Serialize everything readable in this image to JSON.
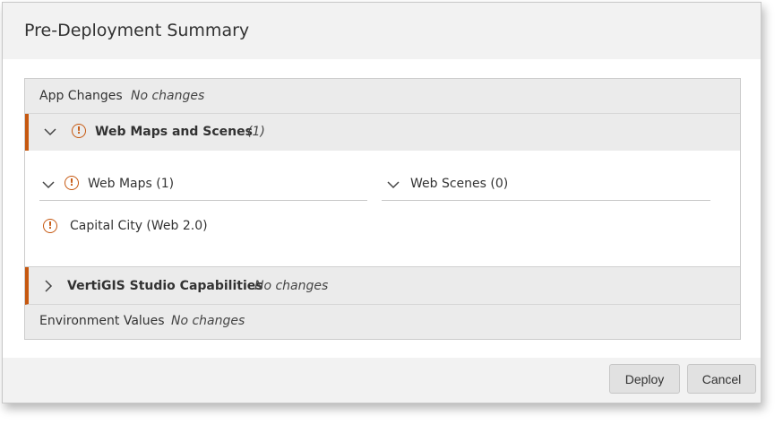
{
  "dialog": {
    "title": "Pre-Deployment Summary",
    "buttons": {
      "deploy": "Deploy",
      "cancel": "Cancel"
    }
  },
  "summary": {
    "app_changes": {
      "label": "App Changes",
      "status": "No changes"
    },
    "web_maps_scenes": {
      "label": "Web Maps and Scenes",
      "count": "(1)",
      "expanded": true,
      "web_maps": {
        "label": "Web Maps (1)",
        "expanded": true,
        "items": [
          {
            "label": "Capital City (Web 2.0)"
          }
        ]
      },
      "web_scenes": {
        "label": "Web Scenes (0)",
        "expanded": true
      }
    },
    "capabilities": {
      "label": "VertiGIS Studio Capabilities",
      "status": "No changes",
      "expanded": false
    },
    "environment_values": {
      "label": "Environment Values",
      "status": "No changes"
    }
  },
  "icons": {
    "warning": "warning-circle-icon",
    "expand": "chevron-down-icon",
    "collapsed": "chevron-right-icon"
  },
  "colors": {
    "warning_accent": "#c65810",
    "header_bg": "#f2f2f2",
    "row_bg": "#ebebeb",
    "button_bg": "#e1e1e1"
  }
}
